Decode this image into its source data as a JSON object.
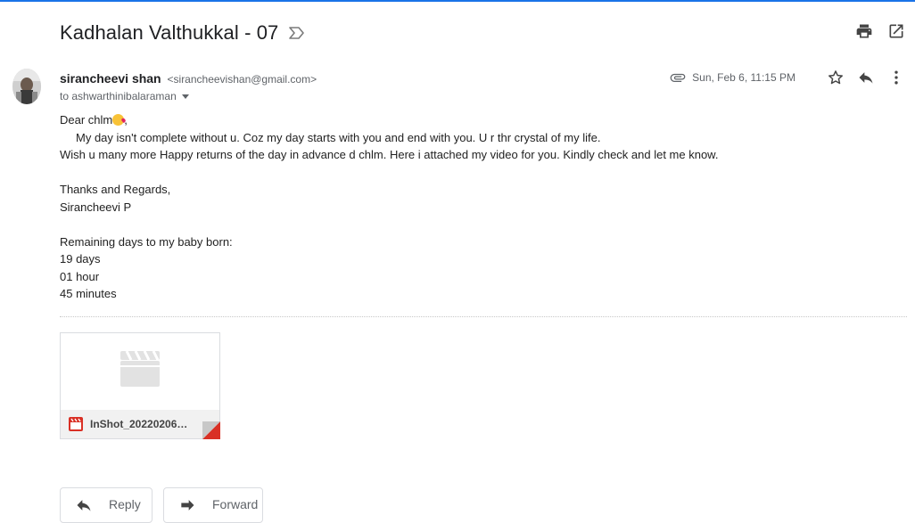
{
  "email": {
    "subject": "Kadhalan Valthukkal - 07",
    "sender_name": "sirancheevi shan",
    "sender_email": "<sirancheevishan@gmail.com>",
    "recipient": "to ashwarthinibalaraman",
    "date": "Sun, Feb 6, 11:15 PM",
    "body_lines": {
      "greeting": "Dear chlm",
      "greeting_suffix": ",",
      "line1": "My day isn't complete without u. Coz my day starts with you and end with you. U r thr crystal of my life.",
      "line2": "Wish u many more Happy returns of the day in advance d chlm. Here i attached my video for you. Kindly check and let me know.",
      "thanks": "Thanks and Regards,",
      "signature": "Sirancheevi P",
      "remaining": "Remaining days to my baby born:",
      "days": "19 days",
      "hours": "01 hour",
      "minutes": "45 minutes"
    }
  },
  "attachment": {
    "file_name": "InShot_20220206_...",
    "file_type_icon": "video-file-icon",
    "accent_color": "#d93025"
  },
  "actions": {
    "reply_label": "Reply",
    "forward_label": "Forward"
  },
  "icons": {
    "important": "important-marker-icon",
    "print": "print-icon",
    "open_new_window": "open-in-new-window-icon",
    "attachment": "paperclip-icon",
    "star": "star-icon",
    "reply": "reply-icon",
    "more": "more-vertical-icon"
  },
  "colors": {
    "accent": "#1a73e8",
    "text": "#222222",
    "muted": "#5f6368"
  }
}
